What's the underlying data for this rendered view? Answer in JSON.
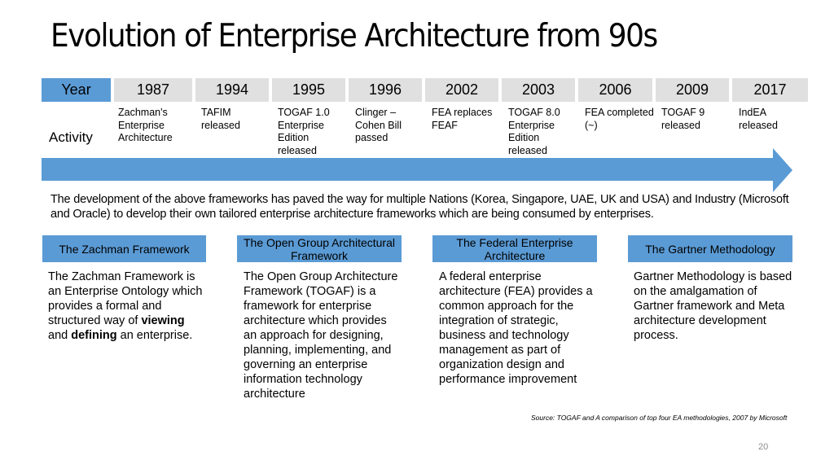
{
  "slide": {
    "title": "Evolution of Enterprise Architecture from 90s",
    "page_number": "20"
  },
  "timeline": {
    "year_label": "Year",
    "activity_label": "Activity",
    "arrow_color": "#5b9bd5",
    "entries": [
      {
        "year": "1987",
        "activity": "Zachman's Enterprise Architecture"
      },
      {
        "year": "1994",
        "activity": "TAFIM released"
      },
      {
        "year": "1995",
        "activity": "TOGAF 1.0 Enterprise Edition released"
      },
      {
        "year": "1996",
        "activity": "Clinger – Cohen Bill passed"
      },
      {
        "year": "2002",
        "activity": "FEA replaces FEAF"
      },
      {
        "year": "2003",
        "activity": "TOGAF 8.0 Enterprise Edition released"
      },
      {
        "year": "2006",
        "activity": "FEA completed (~)"
      },
      {
        "year": "2009",
        "activity": "TOGAF 9 released"
      },
      {
        "year": "2017",
        "activity": "IndEA released"
      }
    ]
  },
  "summary": "The development of the above frameworks has paved the way for multiple Nations (Korea, Singapore, UAE, UK and USA) and Industry (Microsoft and Oracle) to develop their own tailored enterprise architecture frameworks which are being consumed by enterprises.",
  "frameworks": [
    {
      "title": "The Zachman Framework",
      "body_parts": [
        "The Zachman Framework is an Enterprise Ontology which provides a formal and structured way of ",
        "viewing",
        " and ",
        "defining",
        " an enterprise."
      ]
    },
    {
      "title": "The Open Group Architectural Framework",
      "body": "The Open Group Architecture Framework (TOGAF) is a framework for enterprise architecture which provides an approach for designing, planning, implementing, and governing an enterprise information technology architecture"
    },
    {
      "title": "The Federal Enterprise Architecture",
      "body": "A federal enterprise architecture (FEA) provides a common approach for the integration of strategic, business and technology management as part of organization design and performance improvement"
    },
    {
      "title": "The Gartner Methodology",
      "body": "Gartner Methodology is based on the amalgamation of Gartner framework and Meta architecture development process."
    }
  ],
  "source": "Source: TOGAF and  A comparison of top four EA methodologies, 2007 by Microsoft",
  "colors": {
    "accent_blue": "#5b9bd5",
    "year_cell_gray": "#e0e0e0"
  }
}
